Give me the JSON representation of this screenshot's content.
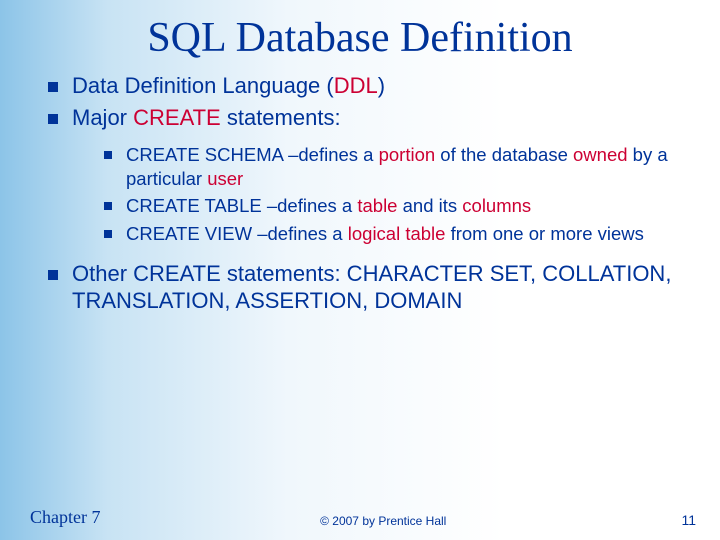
{
  "title": "SQL Database Definition",
  "bullets": {
    "b1_pre": "Data Definition Language (",
    "b1_red": "DDL",
    "b1_post": ")",
    "b2_pre": "Major ",
    "b2_red": "CREATE",
    "b2_post": " statements:",
    "s1_a": "CREATE SCHEMA –defines a ",
    "s1_b": "portion",
    "s1_c": " of the database ",
    "s1_d": "owned",
    "s1_e": " by a particular ",
    "s1_f": "user",
    "s2_a": "CREATE TABLE –defines a ",
    "s2_b": "table",
    "s2_c": " and its ",
    "s2_d": "columns",
    "s3_a": "CREATE VIEW –defines a ",
    "s3_b": "logical table",
    "s3_c": " from one or more views",
    "b3": "Other CREATE statements: CHARACTER SET, COLLATION, TRANSLATION, ASSERTION, DOMAIN"
  },
  "footer": {
    "chapter": "Chapter 7",
    "copyright": "© 2007 by Prentice Hall",
    "page": "11"
  }
}
